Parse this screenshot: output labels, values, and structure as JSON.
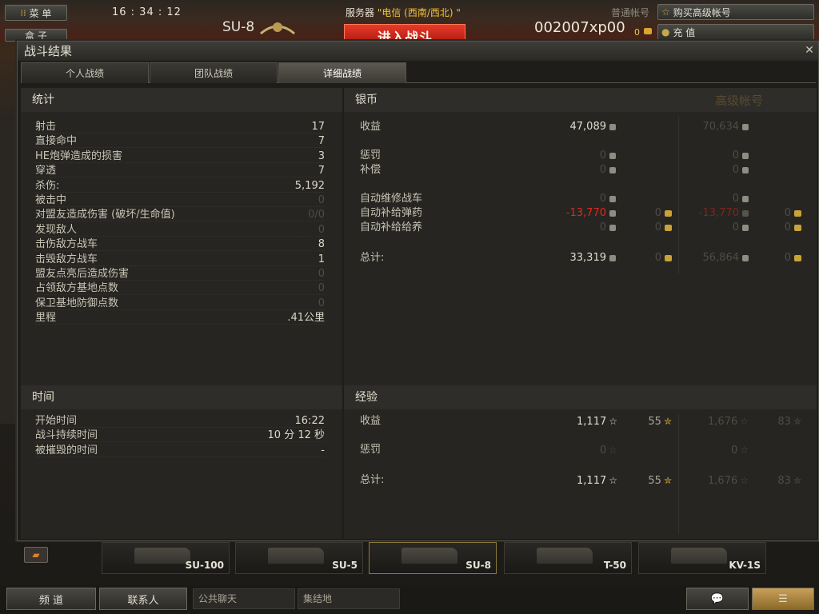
{
  "topbar": {
    "menu_label": "菜 单",
    "depot_label": "盒 子",
    "clock": "16 : 34 : 12",
    "tank_name": "SU-8",
    "server_label": "服务器 ",
    "server_value": "\"电信 (西南/西北) \"",
    "battle_label": "进入战斗",
    "player_name": "002007xp00",
    "gold": "0",
    "account_type": "普通帐号",
    "buy_premium_label": "购买高级帐号",
    "recharge_label": "充 值"
  },
  "dialog": {
    "title": "战斗结果",
    "close_icon": "close-icon",
    "tabs": [
      "个人战绩",
      "团队战绩",
      "详细战绩"
    ],
    "active_tab": 2
  },
  "stats": {
    "header": "统计",
    "rows": [
      {
        "label": "射击",
        "value": "17"
      },
      {
        "label": "直接命中",
        "value": "7"
      },
      {
        "label": "HE炮弹造成的损害",
        "value": "3"
      },
      {
        "label": "穿透",
        "value": "7"
      },
      {
        "label": "杀伤:",
        "value": "5,192"
      },
      {
        "label": "被击中",
        "value": "0",
        "dim": true
      },
      {
        "label": "对盟友造成伤害 (破坏/生命值)",
        "value": "0/0",
        "dim": true
      },
      {
        "label": "发现敌人",
        "value": "0",
        "dim": true
      },
      {
        "label": "击伤敌方战车",
        "value": "8"
      },
      {
        "label": "击毁敌方战车",
        "value": "1"
      },
      {
        "label": "盟友点亮后造成伤害",
        "value": "0",
        "dim": true
      },
      {
        "label": "占领敌方基地点数",
        "value": "0",
        "dim": true
      },
      {
        "label": "保卫基地防御点数",
        "value": "0",
        "dim": true
      },
      {
        "label": "里程",
        "value": ".41公里"
      }
    ]
  },
  "time": {
    "header": "时间",
    "rows": [
      {
        "label": "开始时间",
        "value": "16:22"
      },
      {
        "label": "战斗持续时间",
        "value": "10 分 12 秒"
      },
      {
        "label": "被摧毁的时间",
        "value": "-"
      }
    ]
  },
  "credits": {
    "header": "银币",
    "premium_header": "高级帐号",
    "rows": [
      {
        "label": "收益",
        "credits": "47,089",
        "gold": "",
        "p_credits": "70,634",
        "p_gold": ""
      },
      {
        "label": "惩罚",
        "credits": "0",
        "gold": "",
        "p_credits": "0",
        "p_gold": ""
      },
      {
        "label": "补偿",
        "credits": "0",
        "gold": "",
        "p_credits": "0",
        "p_gold": ""
      },
      {
        "label": "自动维修战车",
        "credits": "0",
        "gold": "",
        "p_credits": "0",
        "p_gold": ""
      },
      {
        "label": "自动补给弹药",
        "credits": "-13,770",
        "gold": "0",
        "p_credits": "-13,770",
        "p_gold": "0"
      },
      {
        "label": "自动补给给养",
        "credits": "0",
        "gold": "0",
        "p_credits": "0",
        "p_gold": "0"
      },
      {
        "label": "总计:",
        "credits": "33,319",
        "gold": "0",
        "p_credits": "56,864",
        "p_gold": "0"
      }
    ]
  },
  "xp": {
    "header": "经验",
    "rows": [
      {
        "label": "收益",
        "xp": "1,117",
        "free": "55",
        "p_xp": "1,676",
        "p_free": "83"
      },
      {
        "label": "惩罚",
        "xp": "0",
        "free": "",
        "p_xp": "0",
        "p_free": ""
      },
      {
        "label": "总计:",
        "xp": "1,117",
        "free": "55",
        "p_xp": "1,676",
        "p_free": "83"
      }
    ]
  },
  "carousel": {
    "tanks": [
      "SU-100",
      "SU-5",
      "SU-8",
      "T-50",
      "KV-1S"
    ],
    "selected": 2
  },
  "bottom": {
    "channel_label": "频 道",
    "contacts_label": "联系人",
    "public_chat": "公共聊天",
    "rally": "集结地"
  },
  "colors": {
    "penalty_red": "#e0281e",
    "gold": "#c9a23a",
    "battle_red": "#d02a1a"
  }
}
